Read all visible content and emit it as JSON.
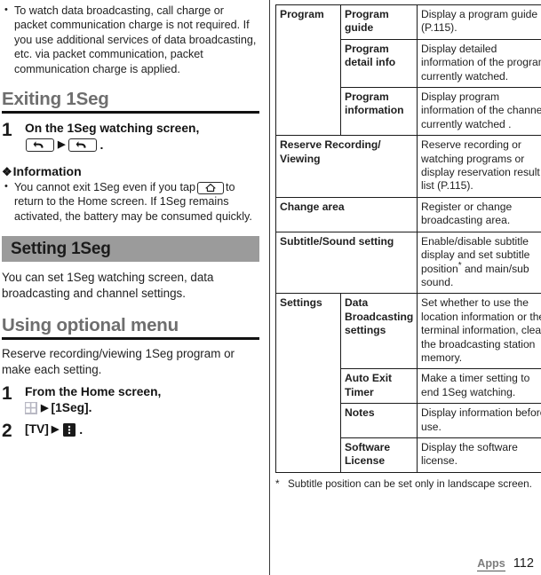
{
  "left": {
    "top_bullets": [
      "To watch data broadcasting, call charge or packet communication charge is not required. If you use additional services of data broadcasting, etc. via packet communication, packet communication charge is applied."
    ],
    "heading_exiting": "Exiting 1Seg",
    "step1": {
      "number": "1",
      "text": "On the 1Seg watching screen,",
      "arrow": "▶",
      "period": "."
    },
    "information": {
      "diamond": "❖",
      "title": "Information",
      "bullet_part1": "You cannot exit 1Seg even if you tap",
      "bullet_part2": "to return to the Home screen. If 1Seg remains activated, the battery may be consumed quickly."
    },
    "band_title": "Setting 1Seg",
    "band_para": "You can set 1Seg watching screen, data broadcasting and channel settings.",
    "heading_optional": "Using optional menu",
    "optional_para": "Reserve recording/viewing 1Seg program or make each setting.",
    "step_home": {
      "number": "1",
      "text": "From the Home screen,",
      "arrow": "▶",
      "target": "[1Seg]."
    },
    "step_tv": {
      "number": "2",
      "label": "[TV]",
      "arrow": "▶",
      "period": "."
    }
  },
  "table": {
    "rows": [
      {
        "group": "Program",
        "group_rowspan": 3,
        "item": "Program guide",
        "desc": "Display a program guide (P.115)."
      },
      {
        "item": "Program detail info",
        "desc": "Display detailed information of the program currently watched."
      },
      {
        "item": "Program information",
        "desc": "Display program information of the channel currently watched ."
      },
      {
        "item_span2": "Reserve Recording/ Viewing",
        "desc": "Reserve recording or watching programs or display reservation result list (P.115)."
      },
      {
        "item_span2": "Change area",
        "desc": "Register or change broadcasting area."
      },
      {
        "item_span2": "Subtitle/Sound setting",
        "desc_pre": "Enable/disable subtitle display and set subtitle position",
        "desc_star": "*",
        "desc_post": " and main/sub sound."
      },
      {
        "group": "Settings",
        "group_rowspan": 4,
        "item": "Data Broadcasting settings",
        "desc": "Set whether to use the location information or the terminal information, clear the broadcasting station memory."
      },
      {
        "item": "Auto Exit Timer",
        "desc": "Make a timer setting to end 1Seg watching."
      },
      {
        "item": "Notes",
        "desc": "Display information before use."
      },
      {
        "item": "Software License",
        "desc": "Display the software license."
      }
    ],
    "footnote_marker": "*",
    "footnote_text": "Subtitle position can be set only in landscape screen."
  },
  "footer": {
    "section_label": "Apps",
    "page_number": "112"
  },
  "colors": {
    "band_bg": "#9b9b9b",
    "heading_gray": "#6e6e6e",
    "rule_black": "#111111",
    "menu_icon_bg": "#1a1a1a",
    "grid_icon_bg": "#b9b9c4"
  }
}
